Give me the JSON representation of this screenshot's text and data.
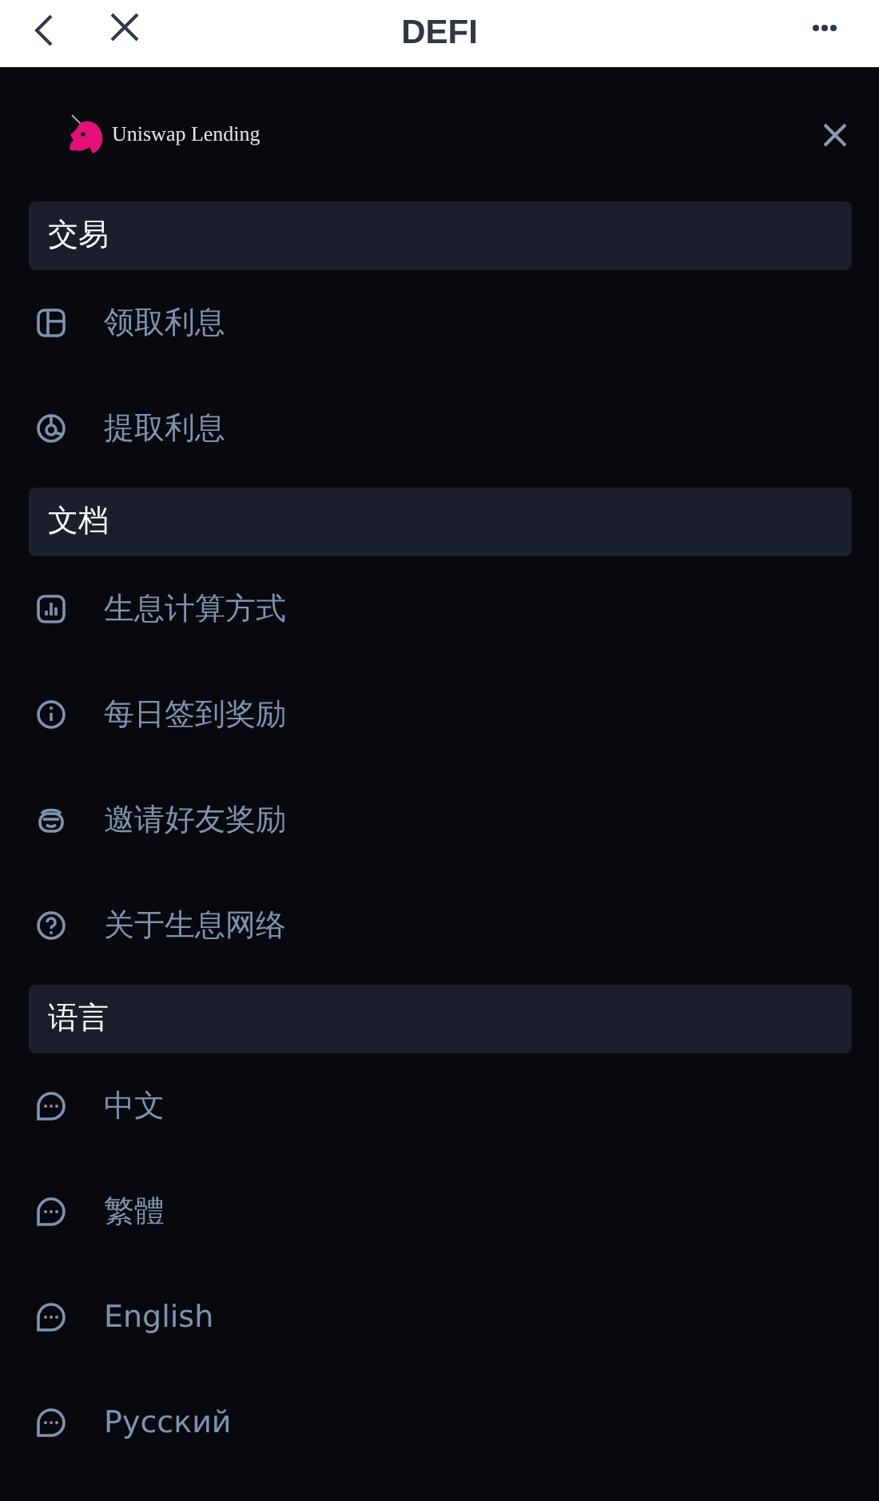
{
  "top_bar": {
    "title": "DEFI"
  },
  "brand": {
    "name": "Uniswap Lending"
  },
  "sections": [
    {
      "title": "交易",
      "items": [
        {
          "label": "领取利息"
        },
        {
          "label": "提取利息"
        }
      ]
    },
    {
      "title": "文档",
      "items": [
        {
          "label": "生息计算方式"
        },
        {
          "label": "每日签到奖励"
        },
        {
          "label": "邀请好友奖励"
        },
        {
          "label": "关于生息网络"
        }
      ]
    },
    {
      "title": "语言",
      "items": [
        {
          "label": "中文"
        },
        {
          "label": "繁體"
        },
        {
          "label": "English"
        },
        {
          "label": "Русский"
        }
      ]
    }
  ]
}
